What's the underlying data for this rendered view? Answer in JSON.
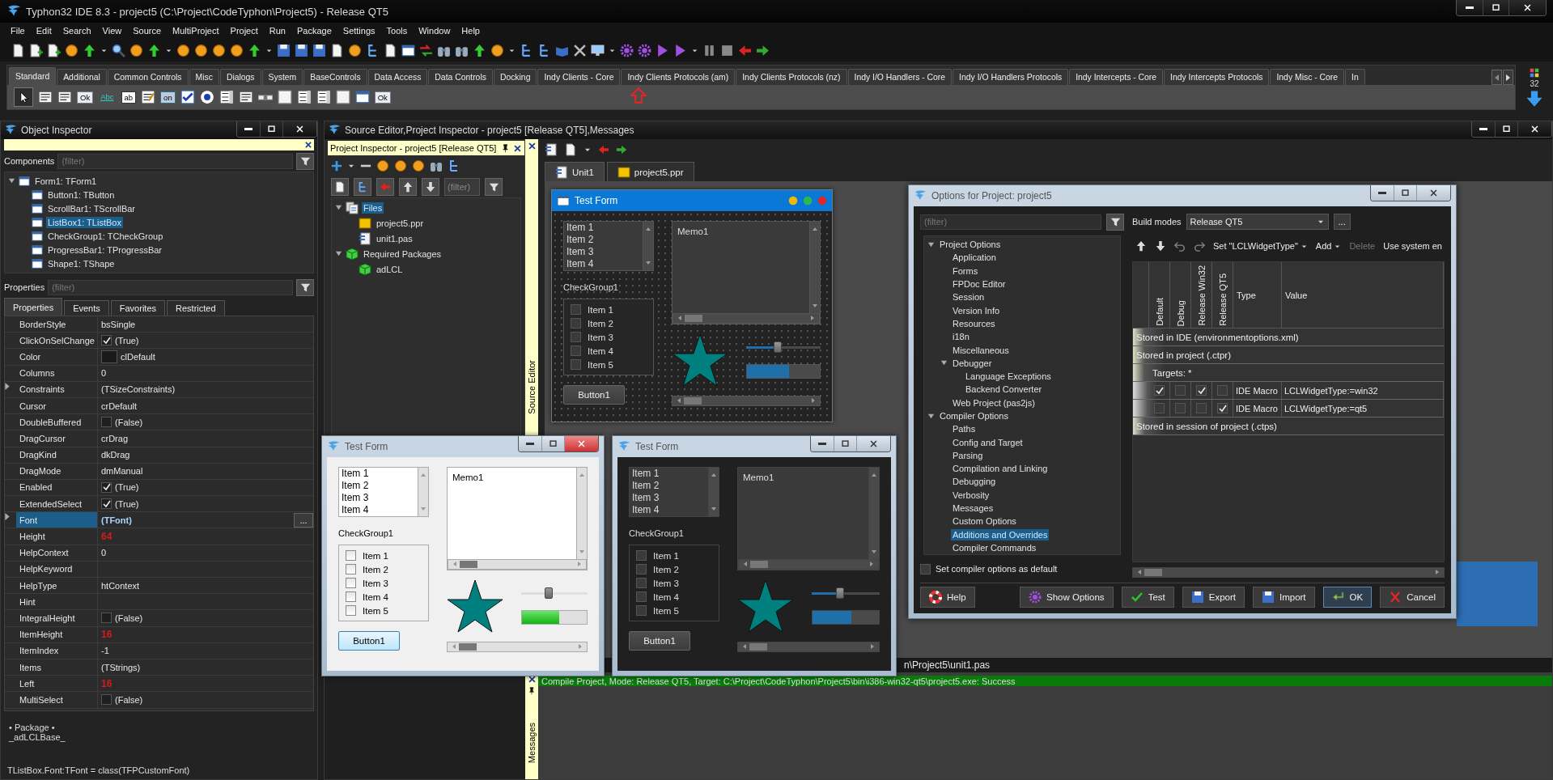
{
  "window": {
    "title": "Typhon32 IDE 8.3 - project5 (C:\\Project\\CodeTyphon\\Project5) - Release QT5"
  },
  "menu": [
    "File",
    "Edit",
    "Search",
    "View",
    "Source",
    "MultiProject",
    "Project",
    "Run",
    "Package",
    "Settings",
    "Tools",
    "Window",
    "Help"
  ],
  "palette": {
    "tabs": [
      {
        "label": "Standard",
        "selected": true
      },
      {
        "label": "Additional",
        "selected": false
      },
      {
        "label": "Common Controls",
        "selected": false
      },
      {
        "label": "Misc",
        "selected": false
      },
      {
        "label": "Dialogs",
        "selected": false
      },
      {
        "label": "System",
        "selected": false
      },
      {
        "label": "BaseControls",
        "selected": false
      },
      {
        "label": "Data Access",
        "selected": false
      },
      {
        "label": "Data Controls",
        "selected": false
      },
      {
        "label": "Docking",
        "selected": false
      },
      {
        "label": "Indy Clients - Core",
        "selected": false
      },
      {
        "label": "Indy Clients Protocols (am)",
        "selected": false
      },
      {
        "label": "Indy Clients Protocols (nz)",
        "selected": false
      },
      {
        "label": "Indy I/O Handlers - Core",
        "selected": false
      },
      {
        "label": "Indy I/O Handlers Protocols",
        "selected": false
      },
      {
        "label": "Indy Intercepts - Core",
        "selected": false
      },
      {
        "label": "Indy Intercepts Protocols",
        "selected": false
      },
      {
        "label": "Indy Misc - Core",
        "selected": false
      },
      {
        "label": "In",
        "selected": false
      }
    ],
    "component_captions": [
      "Ok",
      "Abc",
      "ab",
      "on",
      "Ok"
    ],
    "badge": "32"
  },
  "object_inspector": {
    "title": "Object Inspector",
    "components_label": "Components",
    "components_filter": {
      "placeholder": "(filter)"
    },
    "components": [
      {
        "label": "Form1: TForm1",
        "selected": false,
        "expanded": true,
        "children": [
          {
            "label": "Button1: TButton",
            "selected": false
          },
          {
            "label": "ScrollBar1: TScrollBar",
            "selected": false
          },
          {
            "label": "ListBox1: TListBox",
            "selected": true
          },
          {
            "label": "CheckGroup1: TCheckGroup",
            "selected": false
          },
          {
            "label": "ProgressBar1: TProgressBar",
            "selected": false
          },
          {
            "label": "Shape1: TShape",
            "selected": false
          }
        ]
      }
    ],
    "properties_label": "Properties",
    "properties_filter": {
      "placeholder": "(filter)"
    },
    "tabs": [
      {
        "label": "Properties",
        "selected": true
      },
      {
        "label": "Events",
        "selected": false
      },
      {
        "label": "Favorites",
        "selected": false
      },
      {
        "label": "Restricted",
        "selected": false
      }
    ],
    "properties": [
      {
        "name": "BorderStyle",
        "value": "bsSingle",
        "kind": "text",
        "expandable": false,
        "selected": false,
        "modified": false
      },
      {
        "name": "ClickOnSelChange",
        "value": "(True)",
        "kind": "check",
        "checked": true,
        "expandable": false,
        "selected": false,
        "modified": false
      },
      {
        "name": "Color",
        "value": "clDefault",
        "kind": "color",
        "expandable": false,
        "selected": false,
        "modified": false
      },
      {
        "name": "Columns",
        "value": "0",
        "kind": "text",
        "expandable": false,
        "selected": false,
        "modified": false
      },
      {
        "name": "Constraints",
        "value": "(TSizeConstraints)",
        "kind": "text",
        "expandable": true,
        "selected": false,
        "modified": false
      },
      {
        "name": "Cursor",
        "value": "crDefault",
        "kind": "text",
        "expandable": false,
        "selected": false,
        "modified": false
      },
      {
        "name": "DoubleBuffered",
        "value": "(False)",
        "kind": "check",
        "checked": false,
        "expandable": false,
        "selected": false,
        "modified": false
      },
      {
        "name": "DragCursor",
        "value": "crDrag",
        "kind": "text",
        "expandable": false,
        "selected": false,
        "modified": false
      },
      {
        "name": "DragKind",
        "value": "dkDrag",
        "kind": "text",
        "expandable": false,
        "selected": false,
        "modified": false
      },
      {
        "name": "DragMode",
        "value": "dmManual",
        "kind": "text",
        "expandable": false,
        "selected": false,
        "modified": false
      },
      {
        "name": "Enabled",
        "value": "(True)",
        "kind": "check",
        "checked": true,
        "expandable": false,
        "selected": false,
        "modified": false
      },
      {
        "name": "ExtendedSelect",
        "value": "(True)",
        "kind": "check",
        "checked": true,
        "expandable": false,
        "selected": false,
        "modified": false
      },
      {
        "name": "Font",
        "value": "(TFont)",
        "kind": "text",
        "button": "...",
        "expandable": true,
        "selected": true,
        "modified": false
      },
      {
        "name": "Height",
        "value": "64",
        "kind": "text",
        "expandable": false,
        "selected": false,
        "modified": true
      },
      {
        "name": "HelpContext",
        "value": "0",
        "kind": "text",
        "expandable": false,
        "selected": false,
        "modified": false
      },
      {
        "name": "HelpKeyword",
        "kind": "text",
        "expandable": false,
        "selected": false
      },
      {
        "name": "HelpType",
        "value": "htContext",
        "kind": "text",
        "expandable": false,
        "selected": false,
        "modified": false
      },
      {
        "name": "Hint",
        "kind": "text",
        "expandable": false,
        "selected": false
      },
      {
        "name": "IntegralHeight",
        "value": "(False)",
        "kind": "check",
        "checked": false,
        "expandable": false,
        "selected": false,
        "modified": false
      },
      {
        "name": "ItemHeight",
        "value": "16",
        "kind": "text",
        "expandable": false,
        "selected": false,
        "modified": true
      },
      {
        "name": "ItemIndex",
        "value": "-1",
        "kind": "text",
        "expandable": false,
        "selected": false,
        "modified": false
      },
      {
        "name": "Items",
        "value": "(TStrings)",
        "kind": "text",
        "expandable": false,
        "selected": false,
        "modified": false
      },
      {
        "name": "Left",
        "value": "16",
        "kind": "text",
        "expandable": false,
        "selected": false,
        "modified": true
      },
      {
        "name": "MultiSelect",
        "value": "(False)",
        "kind": "check",
        "checked": false,
        "expandable": false,
        "selected": false,
        "modified": false
      }
    ],
    "help": {
      "title": "• Package •",
      "package": "_adLCLBase_"
    },
    "status": "TListBox.Font:TFont = class(TFPCustomFont)"
  },
  "source_window": {
    "title": "Source Editor,Project Inspector - project5 [Release QT5],Messages",
    "side_label": "Source Editor",
    "tabs": [
      {
        "label": "Unit1",
        "selected": true,
        "kind": "unit"
      },
      {
        "label": "project5.ppr",
        "selected": false,
        "kind": "project"
      }
    ],
    "status_path": "n\\Project5\\unit1.pas"
  },
  "project_inspector": {
    "title": "Project Inspector - project5 [Release QT5]",
    "filter": {
      "placeholder": "(filter)"
    },
    "tree": [
      {
        "label": "Files",
        "kind": "files",
        "selected": true,
        "expanded": true,
        "children": [
          {
            "label": "project5.ppr",
            "kind": "project",
            "selected": false
          },
          {
            "label": "unit1.pas",
            "kind": "unit",
            "selected": false
          }
        ]
      },
      {
        "label": "Required Packages",
        "kind": "packages",
        "selected": false,
        "expanded": true,
        "children": [
          {
            "label": "adLCL",
            "kind": "package",
            "selected": false
          }
        ]
      }
    ]
  },
  "designer_form": {
    "kind": "design",
    "title": "Test Form",
    "list_items": [
      "Item 1",
      "Item 2",
      "Item 3",
      "Item 4"
    ],
    "memo": "Memo1",
    "checkgroup": {
      "caption": "CheckGroup1",
      "items": [
        {
          "label": "Item 1",
          "checked": false
        },
        {
          "label": "Item 2",
          "checked": false
        },
        {
          "label": "Item 3",
          "checked": false
        },
        {
          "label": "Item 4",
          "checked": false
        },
        {
          "label": "Item 5",
          "checked": false
        }
      ]
    },
    "button": "Button1",
    "slider": {
      "level": 0.42
    },
    "progress": {
      "level": 0.58
    }
  },
  "floating_forms": [
    {
      "kind": "light",
      "title": "Test Form",
      "list_items": [
        "Item 1",
        "Item 2",
        "Item 3",
        "Item 4"
      ],
      "memo": "Memo1",
      "checkgroup": {
        "caption": "CheckGroup1",
        "items": [
          {
            "label": "Item 1",
            "checked": false
          },
          {
            "label": "Item 2",
            "checked": false
          },
          {
            "label": "Item 3",
            "checked": false
          },
          {
            "label": "Item 4",
            "checked": false
          },
          {
            "label": "Item 5",
            "checked": false
          }
        ]
      },
      "button": "Button1",
      "slider": {
        "level": 0.42
      },
      "progress": {
        "level": 0.58
      }
    },
    {
      "kind": "dark",
      "title": "Test Form",
      "list_items": [
        "Item 1",
        "Item 2",
        "Item 3",
        "Item 4"
      ],
      "memo": "Memo1",
      "checkgroup": {
        "caption": "CheckGroup1",
        "items": [
          {
            "label": "Item 1",
            "checked": false
          },
          {
            "label": "Item 2",
            "checked": false
          },
          {
            "label": "Item 3",
            "checked": false
          },
          {
            "label": "Item 4",
            "checked": false
          },
          {
            "label": "Item 5",
            "checked": false
          }
        ]
      },
      "button": "Button1",
      "slider": {
        "level": 0.42
      },
      "progress": {
        "level": 0.58
      }
    }
  ],
  "options_dialog": {
    "title": "Options for Project: project5",
    "filter": {
      "placeholder": "(filter)"
    },
    "build_modes_label": "Build modes",
    "build_mode": "Release QT5",
    "build_modes_button": "...",
    "tree": [
      {
        "label": "Project Options",
        "selected": false,
        "expanded": true,
        "children": [
          {
            "label": "Application",
            "selected": false
          },
          {
            "label": "Forms",
            "selected": false
          },
          {
            "label": "FPDoc Editor",
            "selected": false
          },
          {
            "label": "Session",
            "selected": false
          },
          {
            "label": "Version Info",
            "selected": false
          },
          {
            "label": "Resources",
            "selected": false
          },
          {
            "label": "i18n",
            "selected": false
          },
          {
            "label": "Miscellaneous",
            "selected": false
          },
          {
            "label": "Debugger",
            "selected": false,
            "expanded": true,
            "children": [
              {
                "label": "Language Exceptions",
                "selected": false
              },
              {
                "label": "Backend Converter",
                "selected": false
              }
            ]
          },
          {
            "label": "Web Project (pas2js)",
            "selected": false
          }
        ]
      },
      {
        "label": "Compiler Options",
        "selected": false,
        "expanded": true,
        "children": [
          {
            "label": "Paths",
            "selected": false
          },
          {
            "label": "Config and Target",
            "selected": false
          },
          {
            "label": "Parsing",
            "selected": false
          },
          {
            "label": "Compilation and Linking",
            "selected": false
          },
          {
            "label": "Debugging",
            "selected": false
          },
          {
            "label": "Verbosity",
            "selected": false
          },
          {
            "label": "Messages",
            "selected": false
          },
          {
            "label": "Custom Options",
            "selected": false
          },
          {
            "label": "Additions and Overrides",
            "selected": true
          },
          {
            "label": "Compiler Commands",
            "selected": false
          }
        ]
      }
    ],
    "toolbar": [
      {
        "label": "Set \"LCLWidgetType\"",
        "dropdown": true,
        "disabled": false
      },
      {
        "label": "Add",
        "dropdown": true,
        "disabled": false
      },
      {
        "label": "Delete",
        "dropdown": false,
        "disabled": true
      },
      {
        "label": "Use system en",
        "dropdown": false,
        "disabled": false
      }
    ],
    "columns": {
      "modes": [
        "Default",
        "Debug",
        "Release Win32",
        "Release QT5"
      ],
      "type": "Type",
      "value": "Value"
    },
    "rows": [
      {
        "kind": "section",
        "label": "Stored in IDE (environmentoptions.xml)"
      },
      {
        "kind": "section",
        "label": "Stored in project (.ctpr)"
      },
      {
        "kind": "targets",
        "label": "Targets: *"
      },
      {
        "kind": "macro",
        "modes": [
          true,
          false,
          true,
          false
        ],
        "type": "IDE Macro",
        "value": "LCLWidgetType:=win32"
      },
      {
        "kind": "macro",
        "modes": [
          false,
          false,
          false,
          true
        ],
        "type": "IDE Macro",
        "value": "LCLWidgetType:=qt5"
      },
      {
        "kind": "section",
        "label": "Stored in session of project (.ctps)"
      }
    ],
    "default_option": {
      "label": "Set compiler options as default",
      "checked": false
    },
    "buttons": [
      {
        "label": "Help",
        "kind": "help",
        "default": false
      },
      {
        "label": "Show Options",
        "kind": "options",
        "default": false
      },
      {
        "label": "Test",
        "kind": "test",
        "default": false
      },
      {
        "label": "Export",
        "kind": "export",
        "default": false
      },
      {
        "label": "Import",
        "kind": "import",
        "default": false
      },
      {
        "label": "OK",
        "kind": "ok",
        "default": true
      },
      {
        "label": "Cancel",
        "kind": "cancel",
        "default": false
      }
    ]
  },
  "messages": {
    "side_label": "Messages",
    "lines": [
      {
        "text": "Compile Project, Mode: Release QT5, Target: C:\\Project\\CodeTyphon\\Project5\\bin\\i386-win32-qt5\\project5.exe: Success",
        "kind": "success"
      }
    ]
  }
}
